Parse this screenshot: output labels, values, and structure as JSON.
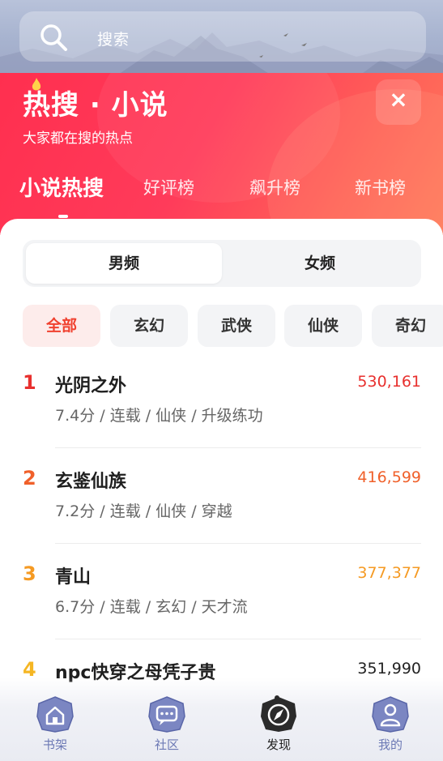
{
  "search": {
    "placeholder": "搜索"
  },
  "header": {
    "title": "热搜 · 小说",
    "subtitle": "大家都在搜的热点",
    "close_label": "×"
  },
  "tabs": [
    {
      "label": "小说热搜",
      "active": true
    },
    {
      "label": "好评榜",
      "active": false
    },
    {
      "label": "飙升榜",
      "active": false
    },
    {
      "label": "新书榜",
      "active": false
    }
  ],
  "gender_toggle": [
    {
      "label": "男频",
      "selected": true
    },
    {
      "label": "女频",
      "selected": false
    }
  ],
  "categories": [
    {
      "label": "全部",
      "active": true
    },
    {
      "label": "玄幻",
      "active": false
    },
    {
      "label": "武侠",
      "active": false
    },
    {
      "label": "仙侠",
      "active": false
    },
    {
      "label": "奇幻",
      "active": false
    }
  ],
  "rankings": [
    {
      "rank": "1",
      "title": "光阴之外",
      "meta": "7.4分 / 连载 / 仙侠 / 升级练功",
      "heat": "530,161",
      "color": "#e8302e"
    },
    {
      "rank": "2",
      "title": "玄鉴仙族",
      "meta": "7.2分 / 连载 / 仙侠 / 穿越",
      "heat": "416,599",
      "color": "#f0602a"
    },
    {
      "rank": "3",
      "title": "青山",
      "meta": "6.7分 / 连载 / 玄幻 / 天才流",
      "heat": "377,377",
      "color": "#f59a23"
    },
    {
      "rank": "4",
      "title": "npc快穿之母凭子贵",
      "meta": "",
      "heat": "351,990",
      "color": "#f5b623"
    }
  ],
  "bottom_nav": [
    {
      "label": "书架",
      "icon": "house-icon",
      "active": false
    },
    {
      "label": "社区",
      "icon": "chat-icon",
      "active": false
    },
    {
      "label": "发现",
      "icon": "compass-icon",
      "active": true
    },
    {
      "label": "我的",
      "icon": "person-icon",
      "active": false
    }
  ],
  "colors": {
    "accent_red": "#ff3355",
    "chip_active_text": "#f0412f",
    "nav_icon": "#7b86c2"
  }
}
